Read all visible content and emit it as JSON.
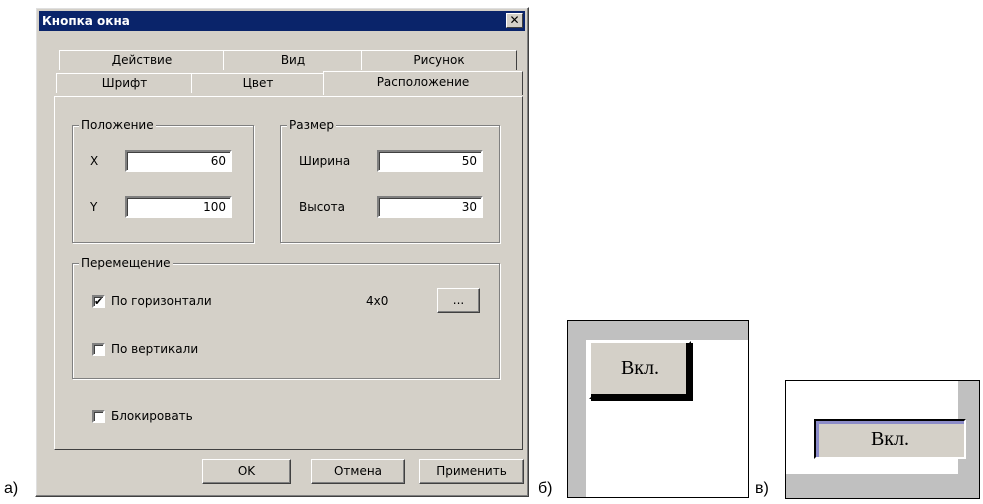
{
  "captions": {
    "a": "а)",
    "b": "б)",
    "c": "в)"
  },
  "dialog": {
    "title": "Кнопка окна",
    "close_glyph": "✕",
    "tabs_back": [
      "Действие",
      "Вид",
      "Рисунок"
    ],
    "tabs_front": [
      "Шрифт",
      "Цвет",
      "Расположение"
    ],
    "position": {
      "legend": "Положение",
      "x_label": "X",
      "x_value": "60",
      "y_label": "Y",
      "y_value": "100"
    },
    "size": {
      "legend": "Размер",
      "width_label": "Ширина",
      "width_value": "50",
      "height_label": "Высота",
      "height_value": "30"
    },
    "movement": {
      "legend": "Перемещение",
      "horizontal_label": "По горизонтали",
      "horizontal_checked": "✔",
      "step_value": "4x0",
      "browse_label": "...",
      "vertical_label": "По вертикали"
    },
    "lock_label": "Блокировать",
    "buttons": {
      "ok": "OK",
      "cancel": "Отмена",
      "apply": "Применить"
    }
  },
  "preview_b": {
    "button_label": "Вкл."
  },
  "preview_c": {
    "button_label": "Вкл."
  },
  "colors": {
    "title_bar": "#0a246a",
    "dialog_bg": "#d4d0c8",
    "preview_bg": "#c0c0c0"
  }
}
